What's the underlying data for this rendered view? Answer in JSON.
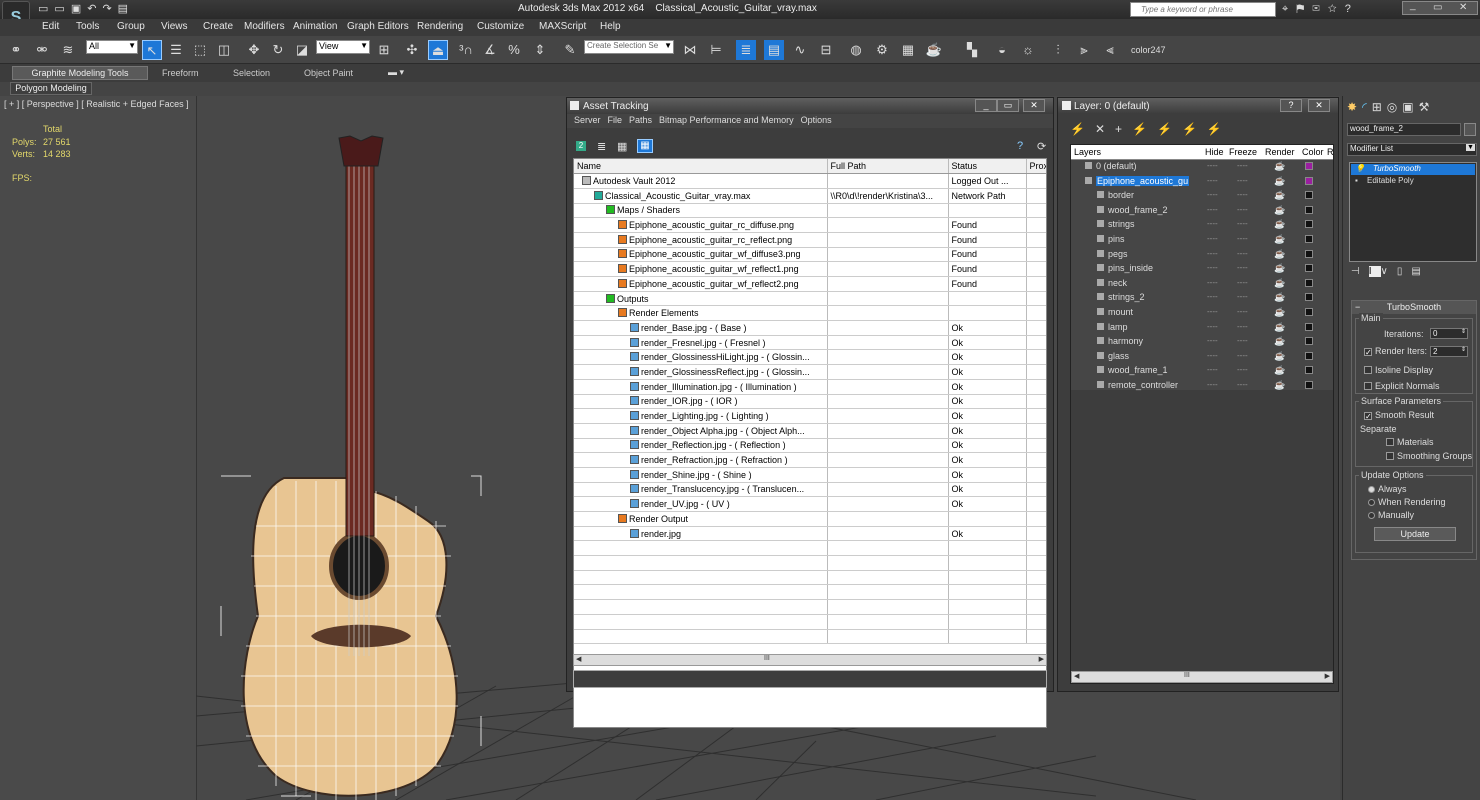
{
  "app": {
    "title": "Autodesk 3ds Max  2012 x64",
    "file": "Classical_Acoustic_Guitar_vray.max",
    "search_placeholder": "Type a keyword or phrase"
  },
  "menu": [
    "Edit",
    "Tools",
    "Group",
    "Views",
    "Create",
    "Modifiers",
    "Animation",
    "Graph Editors",
    "Rendering",
    "Customize",
    "MAXScript",
    "Help"
  ],
  "toolbar": {
    "selection_filter": "All",
    "ref_coord": "View",
    "named_selection_placeholder": "Create Selection Se",
    "color_label": "color247"
  },
  "ribbon": {
    "tabs": [
      "Graphite Modeling Tools",
      "Freeform",
      "Selection",
      "Object Paint"
    ],
    "subpanel": "Polygon Modeling"
  },
  "viewport": {
    "label": "[ + ] [ Perspective ] [ Realistic + Edged Faces ]",
    "stats_header": "Total",
    "polys_label": "Polys:",
    "polys_value": "27 561",
    "verts_label": "Verts:",
    "verts_value": "14 283",
    "fps_label": "FPS:"
  },
  "asset_tracking": {
    "title": "Asset Tracking",
    "menu": [
      "Server",
      "File",
      "Paths",
      "Bitmap Performance and Memory",
      "Options"
    ],
    "columns": [
      "Name",
      "Full Path",
      "Status",
      "Proxy"
    ],
    "rows": [
      {
        "indent": 1,
        "name": "Autodesk Vault 2012",
        "path": "",
        "status": "Logged Out ..."
      },
      {
        "indent": 2,
        "name": "Classical_Acoustic_Guitar_vray.max",
        "path": "\\\\R0\\d\\!render\\Kristina\\3...",
        "status": "Network Path"
      },
      {
        "indent": 3,
        "name": "Maps / Shaders",
        "path": "",
        "status": ""
      },
      {
        "indent": 4,
        "name": "Epiphone_acoustic_guitar_rc_diffuse.png",
        "path": "",
        "status": "Found"
      },
      {
        "indent": 4,
        "name": "Epiphone_acoustic_guitar_rc_reflect.png",
        "path": "",
        "status": "Found"
      },
      {
        "indent": 4,
        "name": "Epiphone_acoustic_guitar_wf_diffuse3.png",
        "path": "",
        "status": "Found"
      },
      {
        "indent": 4,
        "name": "Epiphone_acoustic_guitar_wf_reflect1.png",
        "path": "",
        "status": "Found"
      },
      {
        "indent": 4,
        "name": "Epiphone_acoustic_guitar_wf_reflect2.png",
        "path": "",
        "status": "Found"
      },
      {
        "indent": 3,
        "name": "Outputs",
        "path": "",
        "status": ""
      },
      {
        "indent": 4,
        "name": "Render Elements",
        "path": "",
        "status": ""
      },
      {
        "indent": 5,
        "name": "render_Base.jpg -  ( Base )",
        "path": "",
        "status": "Ok"
      },
      {
        "indent": 5,
        "name": "render_Fresnel.jpg -  ( Fresnel )",
        "path": "",
        "status": "Ok"
      },
      {
        "indent": 5,
        "name": "render_GlossinessHiLight.jpg -  ( Glossin...",
        "path": "",
        "status": "Ok"
      },
      {
        "indent": 5,
        "name": "render_GlossinessReflect.jpg -  ( Glossin...",
        "path": "",
        "status": "Ok"
      },
      {
        "indent": 5,
        "name": "render_Illumination.jpg -  ( Illumination )",
        "path": "",
        "status": "Ok"
      },
      {
        "indent": 5,
        "name": "render_IOR.jpg -  ( IOR )",
        "path": "",
        "status": "Ok"
      },
      {
        "indent": 5,
        "name": "render_Lighting.jpg -  ( Lighting )",
        "path": "",
        "status": "Ok"
      },
      {
        "indent": 5,
        "name": "render_Object Alpha.jpg -  ( Object Alph...",
        "path": "",
        "status": "Ok"
      },
      {
        "indent": 5,
        "name": "render_Reflection.jpg -  ( Reflection )",
        "path": "",
        "status": "Ok"
      },
      {
        "indent": 5,
        "name": "render_Refraction.jpg -  ( Refraction )",
        "path": "",
        "status": "Ok"
      },
      {
        "indent": 5,
        "name": "render_Shine.jpg -  ( Shine )",
        "path": "",
        "status": "Ok"
      },
      {
        "indent": 5,
        "name": "render_Translucency.jpg -  ( Translucen...",
        "path": "",
        "status": "Ok"
      },
      {
        "indent": 5,
        "name": "render_UV.jpg -  ( UV )",
        "path": "",
        "status": "Ok"
      },
      {
        "indent": 4,
        "name": "Render Output",
        "path": "",
        "status": ""
      },
      {
        "indent": 5,
        "name": "render.jpg",
        "path": "",
        "status": "Ok"
      }
    ],
    "scroll_grip": "III"
  },
  "layers": {
    "title": "Layer: 0 (default)",
    "columns": [
      "Layers",
      "Hide",
      "Freeze",
      "Render",
      "Color",
      "R"
    ],
    "items": [
      {
        "name": "0 (default)",
        "indent": 0,
        "color": "#9b1fa0"
      },
      {
        "name": "Epiphone_acoustic_gu",
        "indent": 0,
        "color": "#9b1fa0",
        "selected": true
      },
      {
        "name": "border",
        "indent": 1,
        "color": "#111111"
      },
      {
        "name": "wood_frame_2",
        "indent": 1,
        "color": "#111111"
      },
      {
        "name": "strings",
        "indent": 1,
        "color": "#111111"
      },
      {
        "name": "pins",
        "indent": 1,
        "color": "#111111"
      },
      {
        "name": "pegs",
        "indent": 1,
        "color": "#111111"
      },
      {
        "name": "pins_inside",
        "indent": 1,
        "color": "#111111"
      },
      {
        "name": "neck",
        "indent": 1,
        "color": "#111111"
      },
      {
        "name": "strings_2",
        "indent": 1,
        "color": "#111111"
      },
      {
        "name": "mount",
        "indent": 1,
        "color": "#111111"
      },
      {
        "name": "lamp",
        "indent": 1,
        "color": "#111111"
      },
      {
        "name": "harmony",
        "indent": 1,
        "color": "#111111"
      },
      {
        "name": "glass",
        "indent": 1,
        "color": "#111111"
      },
      {
        "name": "wood_frame_1",
        "indent": 1,
        "color": "#111111"
      },
      {
        "name": "remote_controller",
        "indent": 1,
        "color": "#111111"
      }
    ],
    "dash": "----",
    "scroll_grip": "III"
  },
  "command_panel": {
    "object_name": "wood_frame_2",
    "modifier_list": "Modifier List",
    "stack": [
      "TurboSmooth",
      "Editable Poly"
    ],
    "rollout_title": "TurboSmooth",
    "main_group": "Main",
    "iterations_label": "Iterations:",
    "iterations_value": "0",
    "render_iters_label": "Render Iters:",
    "render_iters_value": "2",
    "isoline_label": "Isoline Display",
    "explicit_normals_label": "Explicit Normals",
    "surface_group": "Surface Parameters",
    "smooth_result_label": "Smooth Result",
    "separate_label": "Separate",
    "materials_label": "Materials",
    "smoothing_groups_label": "Smoothing Groups",
    "update_group": "Update Options",
    "always_label": "Always",
    "when_rendering_label": "When Rendering",
    "manually_label": "Manually",
    "update_button": "Update"
  },
  "colors": {
    "accent_blue": "#1e78d7",
    "layer_purple": "#9b1fa0",
    "stats_yellow": "#e3d86b"
  }
}
